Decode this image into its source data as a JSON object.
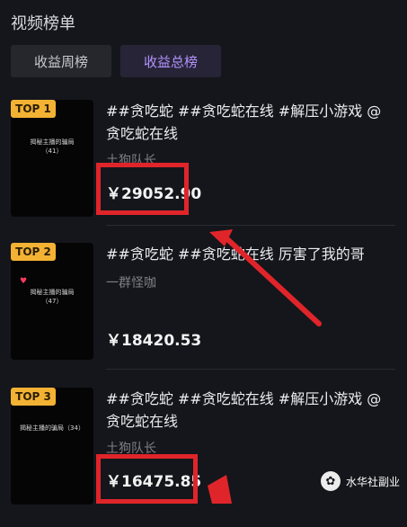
{
  "page": {
    "title": "视频榜单"
  },
  "tabs": [
    {
      "label": "收益周榜"
    },
    {
      "label": "收益总榜"
    }
  ],
  "items": [
    {
      "rank": "TOP 1",
      "thumb_text": "揭秘主播的骗局\n（41）",
      "title": "##贪吃蛇 ##贪吃蛇在线 #解压小游戏 @贪吃蛇在线",
      "author": "土狗队长",
      "price": "￥29052.90"
    },
    {
      "rank": "TOP 2",
      "thumb_text": "揭秘主播的骗局\n（47）",
      "title": "##贪吃蛇 ##贪吃蛇在线 厉害了我的哥",
      "author": "一群怪咖",
      "price": "￥18420.53"
    },
    {
      "rank": "TOP 3",
      "thumb_text": "揭秘主播的骗局（34）",
      "title": "##贪吃蛇 ##贪吃蛇在线 #解压小游戏 @贪吃蛇在线",
      "author": "土狗队长",
      "price": "￥16475.85"
    }
  ],
  "annotations": {
    "highlight_color": "#e0252a"
  },
  "watermark": {
    "text": "水华社副业",
    "icon": "wechat-icon"
  }
}
